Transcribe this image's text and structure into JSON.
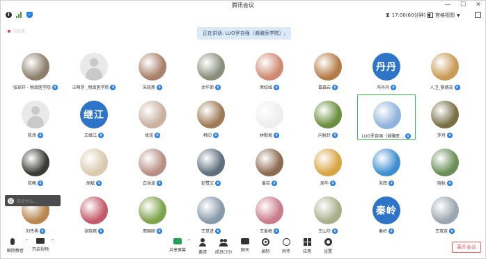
{
  "window": {
    "title": "腾讯会议",
    "minimize": "—",
    "maximize": "☐",
    "close": "✕"
  },
  "topbar": {
    "timer": "17:00(60分钟)",
    "view": "宫格视图"
  },
  "local_user": "刘佳鑫",
  "speaking": "正在讲话: LUO罗自强（湘雅医学院）;",
  "participants": [
    {
      "name": "张琼环 - 税南医学院",
      "avatar": "photo",
      "color": "#8d7f6a"
    },
    {
      "name": "汪萌芽 _税南医学院",
      "avatar": "default",
      "color": "#e9e9e9"
    },
    {
      "name": "朱晓燕",
      "avatar": "photo",
      "color": "#a9806a"
    },
    {
      "name": "余华荣",
      "avatar": "photo",
      "color": "#8a8f7c"
    },
    {
      "name": "席姣娅",
      "avatar": "photo",
      "color": "#cf8a72"
    },
    {
      "name": "葛森岩",
      "avatar": "photo",
      "color": "#b57b45"
    },
    {
      "name": "冯丹丹",
      "avatar": "text",
      "label": "丹丹",
      "color": "#2e74c8"
    },
    {
      "name": "人卫_蔡德茂",
      "avatar": "photo",
      "color": "#c99a56"
    },
    {
      "name": "陈炜",
      "avatar": "default",
      "color": "#e9e9e9"
    },
    {
      "name": "王继江",
      "avatar": "text",
      "label": "继江",
      "color": "#2e74c8"
    },
    {
      "name": "徐茂",
      "avatar": "photo",
      "color": "#c9b0a0"
    },
    {
      "name": "韩印",
      "avatar": "photo",
      "color": "#9d7a55"
    },
    {
      "name": "林默君",
      "avatar": "photo",
      "color": "#eeeeee"
    },
    {
      "name": "向秋玲",
      "avatar": "photo",
      "color": "#6b8f3c"
    },
    {
      "name": "LUO罗自强（湘雅医…",
      "avatar": "photo",
      "color": "#8fb3dc"
    },
    {
      "name": "罗丹",
      "avatar": "photo",
      "color": "#7a7046"
    },
    {
      "name": "陈曦",
      "avatar": "photo",
      "color": "#3a3a35"
    },
    {
      "name": "胡斌",
      "avatar": "photo",
      "color": "#d9cab0"
    },
    {
      "name": "白洪波",
      "avatar": "photo",
      "color": "#b88f85"
    },
    {
      "name": "彭赞文",
      "avatar": "photo",
      "color": "#5f6f7d"
    },
    {
      "name": "姜岩",
      "avatar": "photo",
      "color": "#8d6a50"
    },
    {
      "name": "周华",
      "avatar": "photo",
      "color": "#d9a441"
    },
    {
      "name": "朱辉",
      "avatar": "photo",
      "color": "#3f8fcf"
    },
    {
      "name": "晓秋",
      "avatar": "photo",
      "color": "#6a8e55"
    },
    {
      "name": "刘传勇",
      "avatar": "photo",
      "color": "#b8864e"
    },
    {
      "name": "张晓燕",
      "avatar": "photo",
      "color": "#c45a6a"
    },
    {
      "name": "邢国刚",
      "avatar": "photo",
      "color": "#7ea34a"
    },
    {
      "name": "王觉进",
      "avatar": "photo",
      "color": "#8899aa"
    },
    {
      "name": "王爱梅",
      "avatar": "photo",
      "color": "#c97c8a"
    },
    {
      "name": "王山尔",
      "avatar": "photo",
      "color": "#a8b08a"
    },
    {
      "name": "秦岭",
      "avatar": "text",
      "label": "秦岭",
      "color": "#2e74c8"
    },
    {
      "name": "王双连",
      "avatar": "photo",
      "color": "#9aa6b0"
    }
  ],
  "chat_placeholder": "说点什么...",
  "toolbar": {
    "mute": "解除静音",
    "video": "开启视频",
    "share": "共享屏幕",
    "invite": "邀请",
    "members": "成员(33)",
    "chat": "聊天",
    "record": "录制",
    "interpret": "同传",
    "apps": "应用",
    "settings": "设置",
    "leave": "离开会议"
  },
  "colors": {
    "accent": "#2a7de1",
    "active_border": "#3dbb52",
    "leave": "#e35b5b",
    "speaker_bg": "#dce9f7"
  }
}
